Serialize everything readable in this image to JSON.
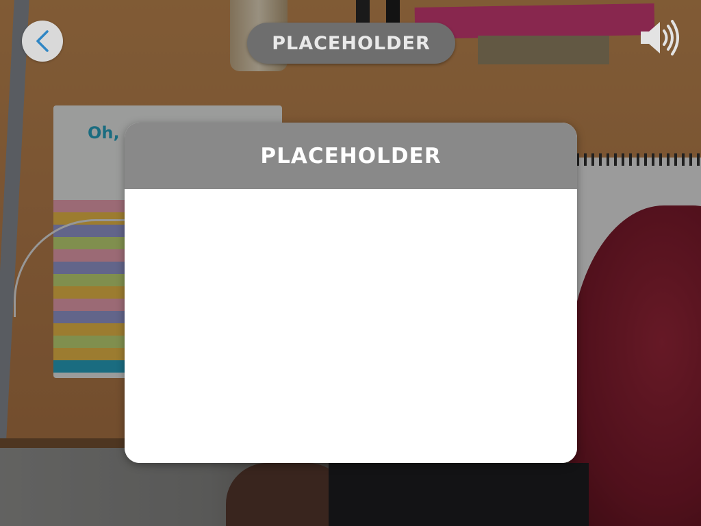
{
  "header": {
    "title": "PLACEHOLDER",
    "back_icon": "chevron-left-icon",
    "sound_icon": "speaker-volume-icon"
  },
  "modal": {
    "title": "PLACEHOLDER",
    "body": ""
  },
  "colors": {
    "back_button_bg": "#d9d9d9",
    "back_chevron": "#2f86c4",
    "title_pill_bg": "#6e6e6e",
    "title_pill_text": "#e9e9e9",
    "modal_header_bg": "#898989",
    "modal_body_bg": "#ffffff",
    "speaker_icon": "#e3e3e3"
  }
}
